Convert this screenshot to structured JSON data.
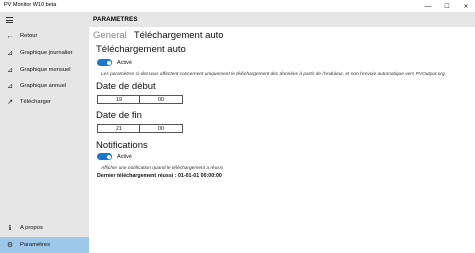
{
  "window": {
    "title": "PV Monitor W10 beta",
    "minimize": "—",
    "maximize": "☐",
    "close": "✕"
  },
  "sidebar": {
    "items": [
      {
        "label": "Retour",
        "icon": "back-arrow-icon",
        "glyph": "←"
      },
      {
        "label": "Graphique journalier",
        "icon": "chart-icon",
        "glyph": "⊿"
      },
      {
        "label": "Graphique mensuel",
        "icon": "chart-icon",
        "glyph": "⊿"
      },
      {
        "label": "Graphique annuel",
        "icon": "chart-icon",
        "glyph": "⊿"
      },
      {
        "label": "Télécharger",
        "icon": "download-icon",
        "glyph": "↗"
      }
    ],
    "bottom_items": [
      {
        "label": "A propos",
        "icon": "info-icon",
        "glyph": "ℹ"
      },
      {
        "label": "Paramètres",
        "icon": "gear-icon",
        "glyph": "⚙"
      }
    ],
    "selected_color": "#9ec8ea"
  },
  "header": {
    "title": "PARAMETRES"
  },
  "tabs": [
    {
      "label": "General",
      "active": false
    },
    {
      "label": "Téléchargement auto",
      "active": true
    }
  ],
  "auto_download": {
    "title": "Téléchargement auto",
    "toggle_label": "Activé",
    "toggle_on": true,
    "note": "Les paramètres ci-dessous affectent concernent uniquement le téléchargement des données à partir de l'onduleur, et non l'envoie automatique vers PVOutput.org."
  },
  "start_time": {
    "title": "Date de début",
    "hour": "19",
    "minute": "00"
  },
  "end_time": {
    "title": "Date de fin",
    "hour": "21",
    "minute": "00"
  },
  "notifications": {
    "title": "Notifications",
    "toggle_label": "Activé",
    "toggle_on": true,
    "note": "Afficher une notification quand le téléchargement a réussi",
    "last_success": "Dernier téléchargement réussi : 01-01-01 00:00:00"
  },
  "accent_color": "#1976d2"
}
